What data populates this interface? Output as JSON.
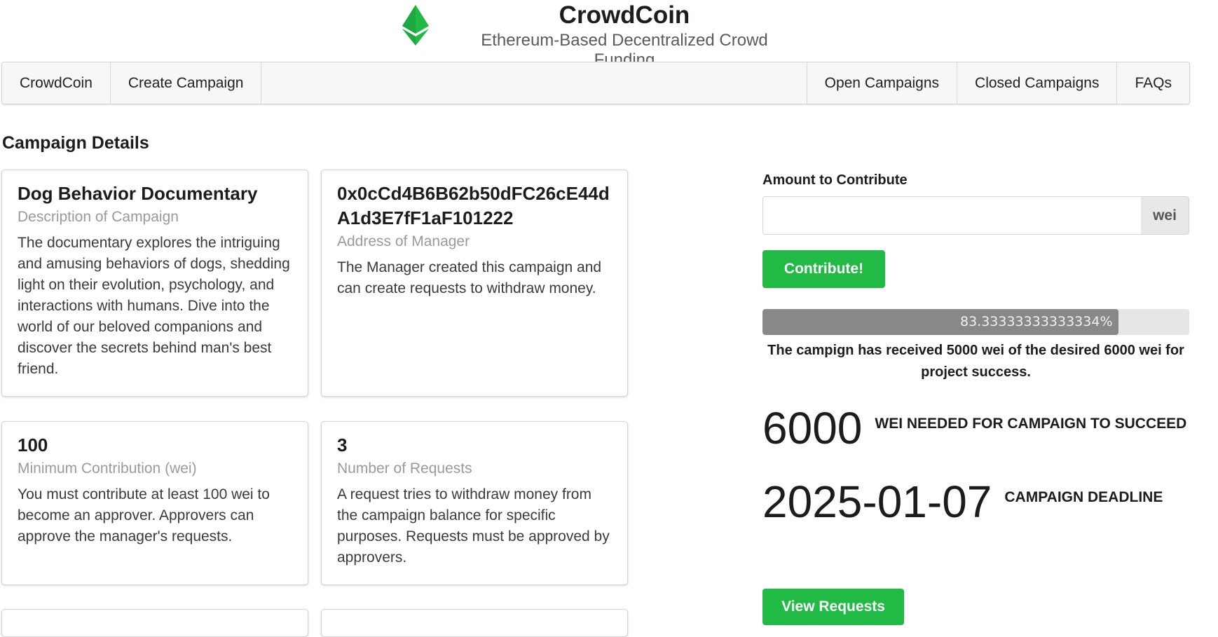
{
  "header": {
    "title": "CrowdCoin",
    "subtitle": "Ethereum-Based Decentralized Crowd Funding",
    "logo_icon": "ethereum-icon",
    "logo_color": "#21ba45"
  },
  "menu": {
    "left": [
      "CrowdCoin",
      "Create Campaign"
    ],
    "right": [
      "Open Campaigns",
      "Closed Campaigns",
      "FAQs"
    ]
  },
  "page": {
    "section_title": "Campaign Details"
  },
  "cards": [
    {
      "header": "Dog Behavior Documentary",
      "meta": "Description of Campaign",
      "description": "The documentary explores the intriguing and amusing behaviors of dogs, shedding light on their evolution, psychology, and interactions with humans. Dive into the world of our beloved companions and discover the secrets behind man's best friend."
    },
    {
      "header": "0x0cCd4B6B62b50dFC26cE44dA1d3E7fF1aF101222",
      "meta": "Address of Manager",
      "description": "The Manager created this campaign and can create requests to withdraw money."
    },
    {
      "header": "100",
      "meta": "Minimum Contribution (wei)",
      "description": "You must contribute at least 100 wei to become an approver. Approvers can approve the manager's requests."
    },
    {
      "header": "3",
      "meta": "Number of Requests",
      "description": "A request tries to withdraw money from the campaign balance for specific purposes. Requests must be approved by approvers."
    },
    {
      "header": "",
      "meta": "",
      "description": ""
    },
    {
      "header": "",
      "meta": "",
      "description": ""
    }
  ],
  "contribute": {
    "label": "Amount to Contribute",
    "value": "",
    "unit": "wei",
    "button": "Contribute!",
    "button_color": "#21ba45"
  },
  "progress": {
    "percent": 83.33333333333334,
    "text": "83.33333333333334%",
    "label": "The campign has received 5000 wei of the desired 6000 wei for project success."
  },
  "stats": [
    {
      "value": "6000",
      "label": "WEI NEEDED FOR CAMPAIGN TO SUCCEED"
    },
    {
      "value": "2025-01-07",
      "label": "CAMPAIGN DEADLINE"
    }
  ],
  "actions": {
    "view_requests": "View Requests"
  }
}
